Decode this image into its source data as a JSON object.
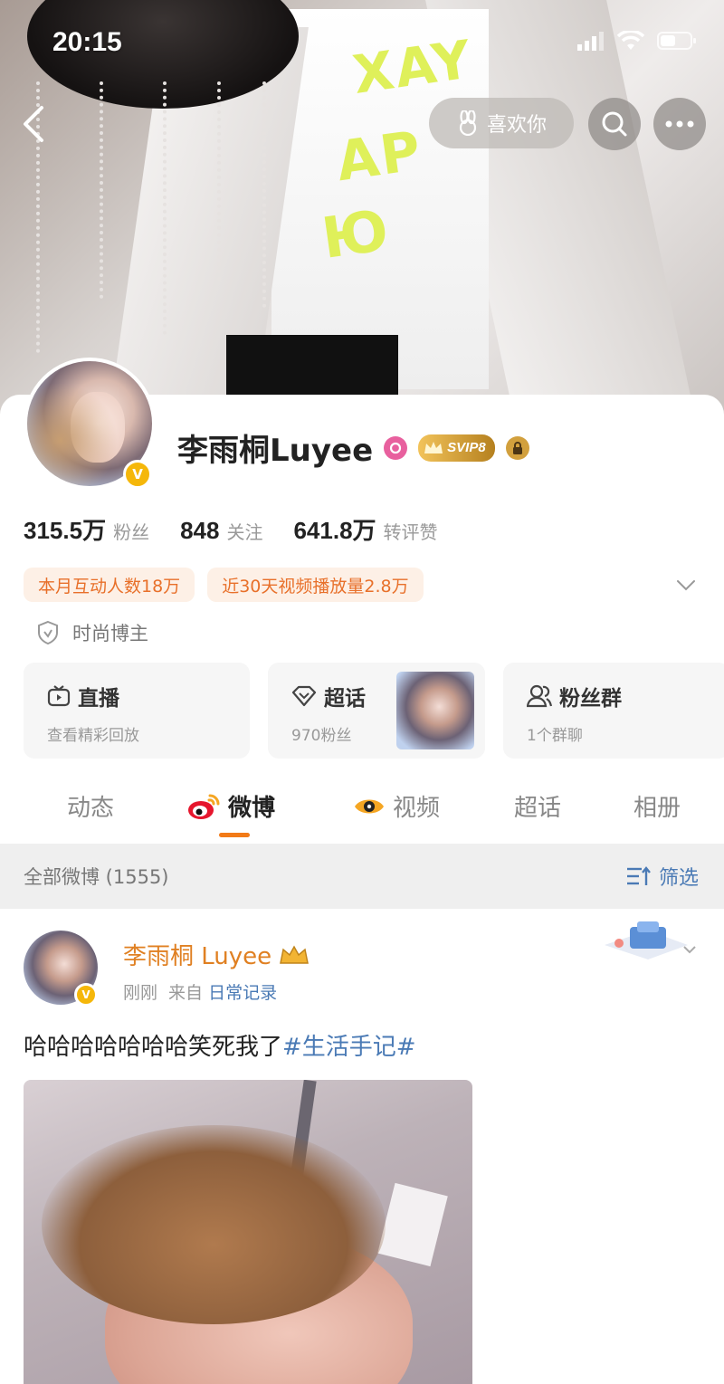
{
  "status_bar": {
    "time": "20:15"
  },
  "cover": {
    "print_lines": [
      "XAY",
      "AP",
      "Ю"
    ],
    "like_button": "喜欢你"
  },
  "profile": {
    "name": "李雨桐Luyee",
    "vip_badge": "SVIP8",
    "stats": [
      {
        "value": "315.5万",
        "label": "粉丝"
      },
      {
        "value": "848",
        "label": "关注"
      },
      {
        "value": "641.8万",
        "label": "转评赞"
      }
    ],
    "tags": [
      "本月互动人数18万",
      "近30天视频播放量2.8万"
    ],
    "certification": "时尚博主"
  },
  "tiles": [
    {
      "title": "直播",
      "subtitle": "查看精彩回放",
      "icon": "tv-icon"
    },
    {
      "title": "超话",
      "subtitle": "970粉丝",
      "icon": "diamond-icon"
    },
    {
      "title": "粉丝群",
      "subtitle": "1个群聊",
      "icon": "group-icon"
    }
  ],
  "tabs": [
    {
      "label": "动态",
      "active": false
    },
    {
      "label": "微博",
      "active": true
    },
    {
      "label": "视频",
      "active": false
    },
    {
      "label": "超话",
      "active": false
    },
    {
      "label": "相册",
      "active": false
    }
  ],
  "feed_header": {
    "title": "全部微博 (1555)",
    "filter_label": "筛选"
  },
  "post": {
    "author": "李雨桐 Luyee",
    "time": "刚刚",
    "source_prefix": "来自",
    "source": "日常记录",
    "text": "哈哈哈哈哈哈哈笑死我了",
    "topic": "#生活手记#"
  },
  "colors": {
    "accent_orange": "#f27a17",
    "link_blue": "#4a7ab5",
    "verified_gold": "#f5b70a",
    "tag_bg": "#fdf0e6",
    "tag_text": "#e8702a"
  }
}
